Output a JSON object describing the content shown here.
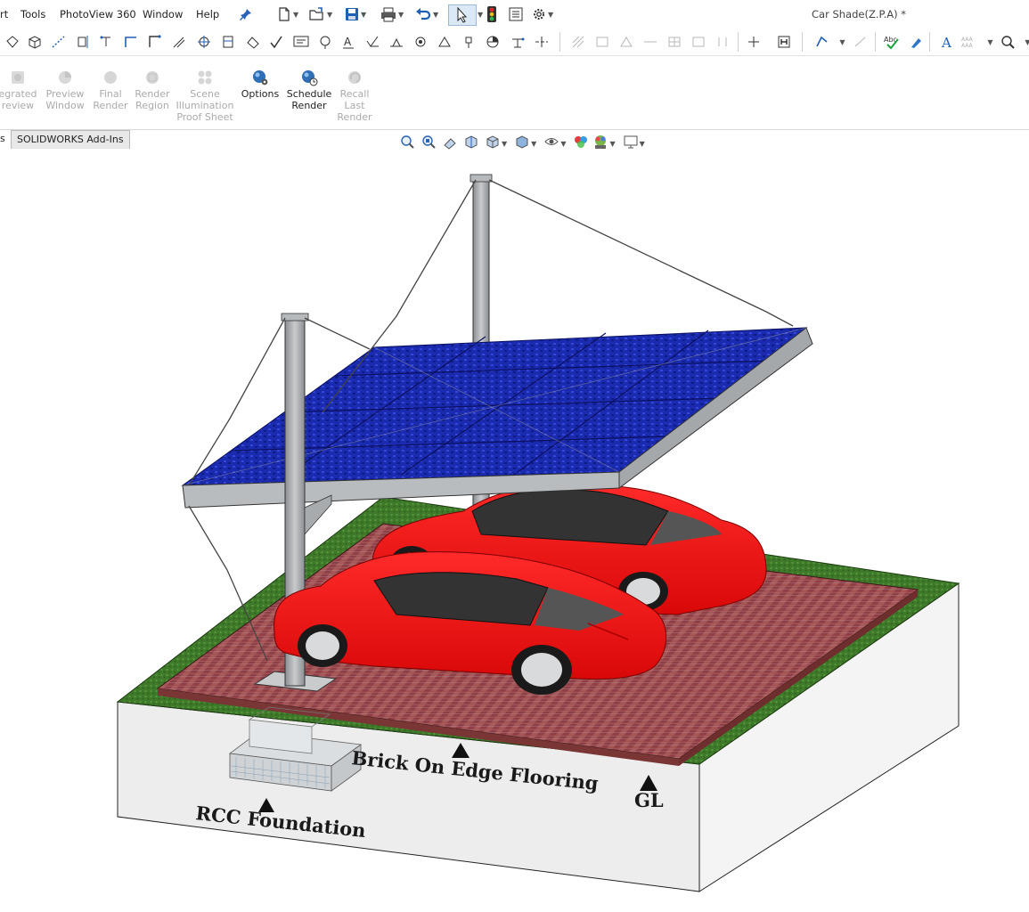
{
  "menubar": {
    "items": [
      "rt",
      "Tools",
      "PhotoView 360",
      "Window",
      "Help"
    ],
    "document_title": "Car Shade(Z.P.A) *"
  },
  "ribbon": {
    "buttons": [
      {
        "label": "egrated\nreview",
        "enabled": false
      },
      {
        "label": "Preview\nWindow",
        "enabled": false
      },
      {
        "label": "Final\nRender",
        "enabled": false
      },
      {
        "label": "Render\nRegion",
        "enabled": false
      },
      {
        "label": "Scene\nIllumination\nProof Sheet",
        "enabled": false
      },
      {
        "label": "Options",
        "enabled": true
      },
      {
        "label": "Schedule\nRender",
        "enabled": true
      },
      {
        "label": "Recall\nLast\nRender",
        "enabled": false
      }
    ]
  },
  "tabs": {
    "items": [
      "s",
      "SOLIDWORKS Add-Ins"
    ],
    "active": "SOLIDWORKS Add-Ins"
  },
  "model": {
    "labels": {
      "foundation": "RCC Foundation",
      "flooring": "Brick On Edge Flooring",
      "ground_level": "GL"
    },
    "colors": {
      "car": "#ee1010",
      "solar_panel": "#1a2bb0",
      "steel": "#a9acb0",
      "brick": "#9c4a4a",
      "grass": "#3f7a2a",
      "soil": "#ededed"
    }
  }
}
